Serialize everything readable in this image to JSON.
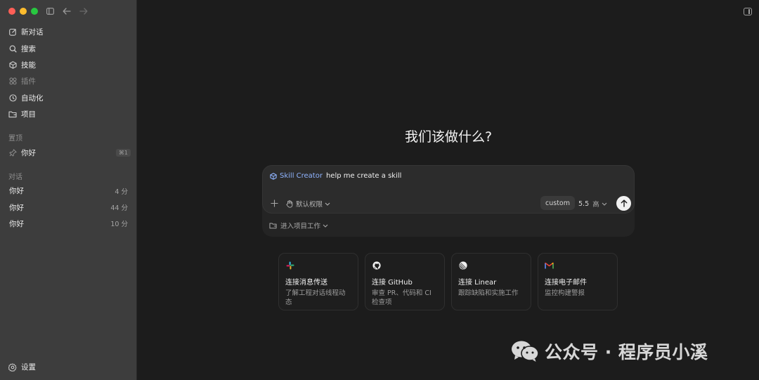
{
  "colors": {
    "sidebar_bg": "#3d3d3d",
    "main_bg": "#1c1c1c",
    "accent_skill": "#8fb4ff",
    "traffic_red": "#ff5f57",
    "traffic_yellow": "#febc2e",
    "traffic_green": "#28c840"
  },
  "sidebar": {
    "nav": [
      {
        "label": "新对话",
        "icon": "edit-icon"
      },
      {
        "label": "搜索",
        "icon": "search-icon"
      },
      {
        "label": "技能",
        "icon": "skill-icon"
      },
      {
        "label": "插件",
        "icon": "plugin-icon"
      },
      {
        "label": "自动化",
        "icon": "clock-icon"
      },
      {
        "label": "项目",
        "icon": "folder-icon"
      }
    ],
    "pinned_label": "置顶",
    "pinned": {
      "label": "你好",
      "shortcut": "⌘1",
      "icon": "pin-icon"
    },
    "conversations_label": "对话",
    "conversations": [
      {
        "label": "你好",
        "time": "4 分"
      },
      {
        "label": "你好",
        "time": "44 分"
      },
      {
        "label": "你好",
        "time": "10 分"
      }
    ],
    "settings_label": "设置"
  },
  "main": {
    "headline": "我们该做什么?",
    "composer": {
      "skill_name": "Skill Creator",
      "prompt_text": "help me create a skill",
      "permission_label": "默认权限",
      "custom_label": "custom",
      "model_version": "5.5",
      "model_level": "高",
      "project_label": "进入项目工作"
    },
    "cards": [
      {
        "title": "连接消息传送",
        "desc": "了解工程对话线程动态",
        "icon": "slack-icon"
      },
      {
        "title": "连接 GitHub",
        "desc": "审查 PR、代码和 CI 检查项",
        "icon": "github-icon"
      },
      {
        "title": "连接 Linear",
        "desc": "跟踪缺陷和实施工作",
        "icon": "linear-icon"
      },
      {
        "title": "连接电子邮件",
        "desc": "监控构建警报",
        "icon": "gmail-icon"
      }
    ]
  },
  "watermark": {
    "text": "公众号 · 程序员小溪",
    "icon": "wechat-icon"
  }
}
